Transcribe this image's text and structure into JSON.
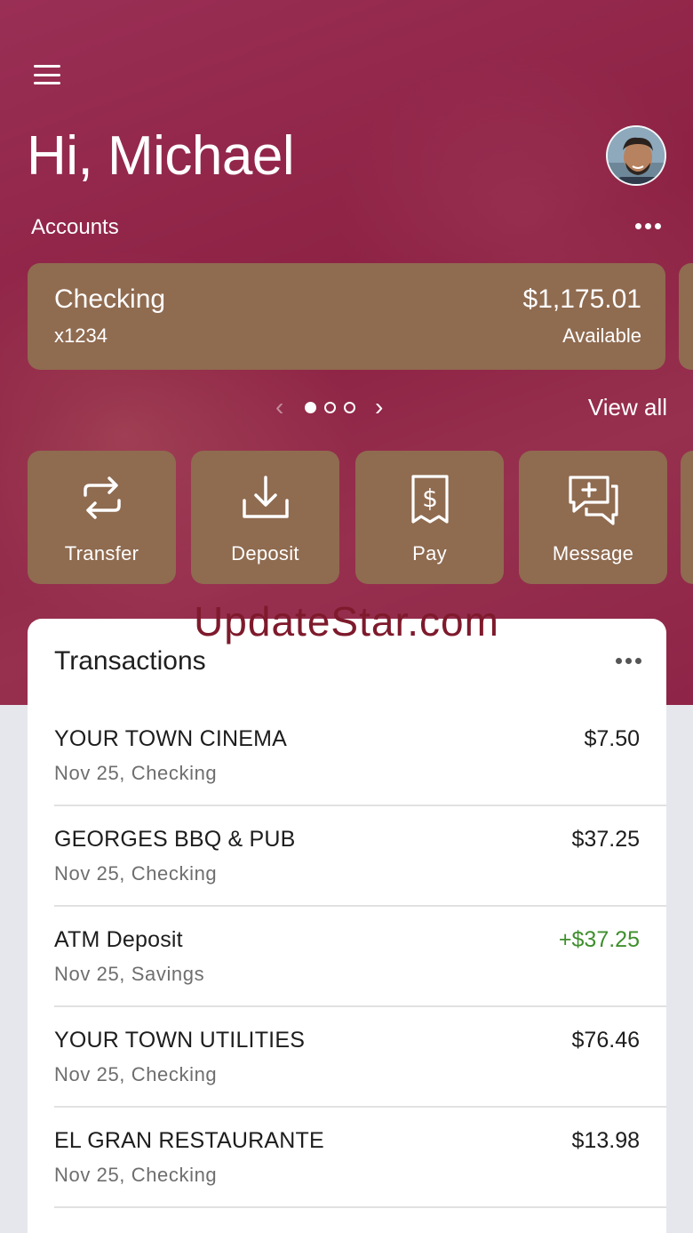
{
  "greeting": "Hi, Michael",
  "accounts": {
    "label": "Accounts",
    "card": {
      "name": "Checking",
      "number": "x1234",
      "balance": "$1,175.01",
      "balance_label": "Available"
    },
    "pager": {
      "count": 3,
      "active": 0
    },
    "view_all": "View all"
  },
  "actions": [
    {
      "label": "Transfer",
      "icon": "transfer-icon"
    },
    {
      "label": "Deposit",
      "icon": "deposit-icon"
    },
    {
      "label": "Pay",
      "icon": "pay-bill-icon"
    },
    {
      "label": "Message",
      "icon": "message-icon"
    }
  ],
  "watermark": "UpdateStar.com",
  "transactions": {
    "title": "Transactions",
    "items": [
      {
        "merchant": "YOUR TOWN CINEMA",
        "detail": "Nov 25, Checking",
        "amount": "$7.50",
        "positive": false
      },
      {
        "merchant": "GEORGES BBQ & PUB",
        "detail": "Nov 25, Checking",
        "amount": "$37.25",
        "positive": false
      },
      {
        "merchant": "ATM Deposit",
        "detail": "Nov 25, Savings",
        "amount": "+$37.25",
        "positive": true
      },
      {
        "merchant": "YOUR TOWN UTILITIES",
        "detail": "Nov 25, Checking",
        "amount": "$76.46",
        "positive": false
      },
      {
        "merchant": "EL GRAN RESTAURANTE",
        "detail": "Nov 25, Checking",
        "amount": "$13.98",
        "positive": false
      }
    ]
  },
  "colors": {
    "hero": "#8c2143",
    "card": "#8f6b50",
    "positive": "#3f8f2d"
  }
}
